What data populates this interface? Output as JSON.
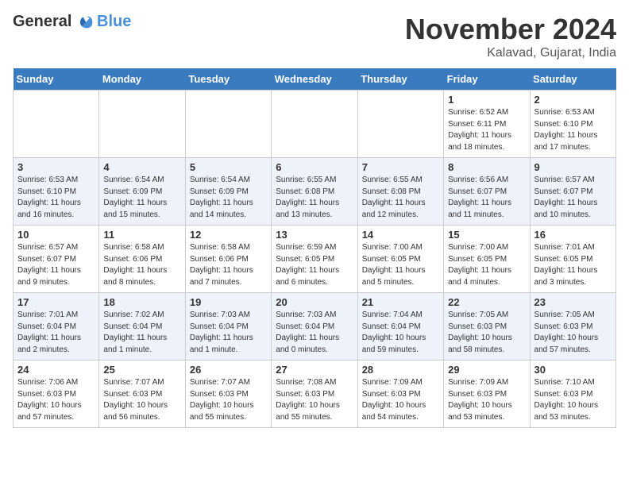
{
  "header": {
    "logo_line1": "General",
    "logo_line2": "Blue",
    "month_title": "November 2024",
    "location": "Kalavad, Gujarat, India"
  },
  "days_of_week": [
    "Sunday",
    "Monday",
    "Tuesday",
    "Wednesday",
    "Thursday",
    "Friday",
    "Saturday"
  ],
  "weeks": [
    [
      {
        "day": "",
        "info": ""
      },
      {
        "day": "",
        "info": ""
      },
      {
        "day": "",
        "info": ""
      },
      {
        "day": "",
        "info": ""
      },
      {
        "day": "",
        "info": ""
      },
      {
        "day": "1",
        "info": "Sunrise: 6:52 AM\nSunset: 6:11 PM\nDaylight: 11 hours\nand 18 minutes."
      },
      {
        "day": "2",
        "info": "Sunrise: 6:53 AM\nSunset: 6:10 PM\nDaylight: 11 hours\nand 17 minutes."
      }
    ],
    [
      {
        "day": "3",
        "info": "Sunrise: 6:53 AM\nSunset: 6:10 PM\nDaylight: 11 hours\nand 16 minutes."
      },
      {
        "day": "4",
        "info": "Sunrise: 6:54 AM\nSunset: 6:09 PM\nDaylight: 11 hours\nand 15 minutes."
      },
      {
        "day": "5",
        "info": "Sunrise: 6:54 AM\nSunset: 6:09 PM\nDaylight: 11 hours\nand 14 minutes."
      },
      {
        "day": "6",
        "info": "Sunrise: 6:55 AM\nSunset: 6:08 PM\nDaylight: 11 hours\nand 13 minutes."
      },
      {
        "day": "7",
        "info": "Sunrise: 6:55 AM\nSunset: 6:08 PM\nDaylight: 11 hours\nand 12 minutes."
      },
      {
        "day": "8",
        "info": "Sunrise: 6:56 AM\nSunset: 6:07 PM\nDaylight: 11 hours\nand 11 minutes."
      },
      {
        "day": "9",
        "info": "Sunrise: 6:57 AM\nSunset: 6:07 PM\nDaylight: 11 hours\nand 10 minutes."
      }
    ],
    [
      {
        "day": "10",
        "info": "Sunrise: 6:57 AM\nSunset: 6:07 PM\nDaylight: 11 hours\nand 9 minutes."
      },
      {
        "day": "11",
        "info": "Sunrise: 6:58 AM\nSunset: 6:06 PM\nDaylight: 11 hours\nand 8 minutes."
      },
      {
        "day": "12",
        "info": "Sunrise: 6:58 AM\nSunset: 6:06 PM\nDaylight: 11 hours\nand 7 minutes."
      },
      {
        "day": "13",
        "info": "Sunrise: 6:59 AM\nSunset: 6:05 PM\nDaylight: 11 hours\nand 6 minutes."
      },
      {
        "day": "14",
        "info": "Sunrise: 7:00 AM\nSunset: 6:05 PM\nDaylight: 11 hours\nand 5 minutes."
      },
      {
        "day": "15",
        "info": "Sunrise: 7:00 AM\nSunset: 6:05 PM\nDaylight: 11 hours\nand 4 minutes."
      },
      {
        "day": "16",
        "info": "Sunrise: 7:01 AM\nSunset: 6:05 PM\nDaylight: 11 hours\nand 3 minutes."
      }
    ],
    [
      {
        "day": "17",
        "info": "Sunrise: 7:01 AM\nSunset: 6:04 PM\nDaylight: 11 hours\nand 2 minutes."
      },
      {
        "day": "18",
        "info": "Sunrise: 7:02 AM\nSunset: 6:04 PM\nDaylight: 11 hours\nand 1 minute."
      },
      {
        "day": "19",
        "info": "Sunrise: 7:03 AM\nSunset: 6:04 PM\nDaylight: 11 hours\nand 1 minute."
      },
      {
        "day": "20",
        "info": "Sunrise: 7:03 AM\nSunset: 6:04 PM\nDaylight: 11 hours\nand 0 minutes."
      },
      {
        "day": "21",
        "info": "Sunrise: 7:04 AM\nSunset: 6:04 PM\nDaylight: 10 hours\nand 59 minutes."
      },
      {
        "day": "22",
        "info": "Sunrise: 7:05 AM\nSunset: 6:03 PM\nDaylight: 10 hours\nand 58 minutes."
      },
      {
        "day": "23",
        "info": "Sunrise: 7:05 AM\nSunset: 6:03 PM\nDaylight: 10 hours\nand 57 minutes."
      }
    ],
    [
      {
        "day": "24",
        "info": "Sunrise: 7:06 AM\nSunset: 6:03 PM\nDaylight: 10 hours\nand 57 minutes."
      },
      {
        "day": "25",
        "info": "Sunrise: 7:07 AM\nSunset: 6:03 PM\nDaylight: 10 hours\nand 56 minutes."
      },
      {
        "day": "26",
        "info": "Sunrise: 7:07 AM\nSunset: 6:03 PM\nDaylight: 10 hours\nand 55 minutes."
      },
      {
        "day": "27",
        "info": "Sunrise: 7:08 AM\nSunset: 6:03 PM\nDaylight: 10 hours\nand 55 minutes."
      },
      {
        "day": "28",
        "info": "Sunrise: 7:09 AM\nSunset: 6:03 PM\nDaylight: 10 hours\nand 54 minutes."
      },
      {
        "day": "29",
        "info": "Sunrise: 7:09 AM\nSunset: 6:03 PM\nDaylight: 10 hours\nand 53 minutes."
      },
      {
        "day": "30",
        "info": "Sunrise: 7:10 AM\nSunset: 6:03 PM\nDaylight: 10 hours\nand 53 minutes."
      }
    ]
  ]
}
